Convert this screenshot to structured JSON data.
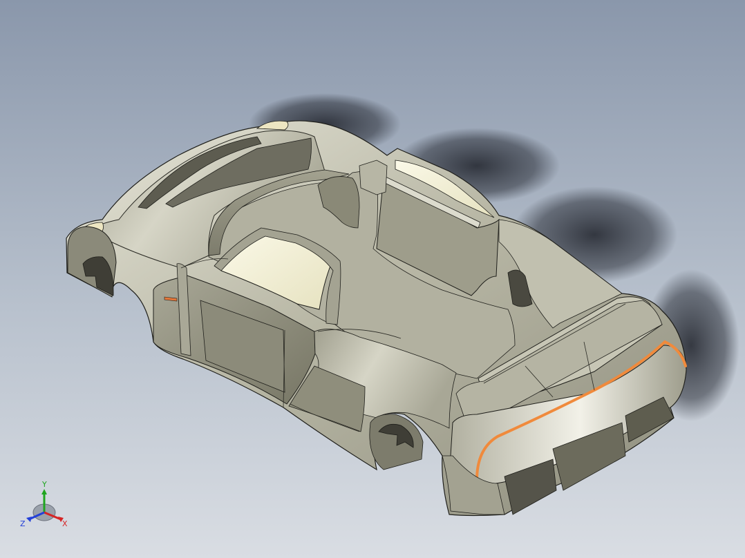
{
  "viewport": {
    "background_top": "#8a97ab",
    "background_bottom": "#d9dde3"
  },
  "model": {
    "body_color": "#c9c8b8",
    "shadow_color": "#2b2f38",
    "accent_edge_color": "#f08a3c",
    "glass_color": "#f4f1d8"
  },
  "triad": {
    "x_label": "X",
    "y_label": "Y",
    "z_label": "Z",
    "x_color": "#d62424",
    "y_color": "#1fa51f",
    "z_color": "#2340d8"
  }
}
